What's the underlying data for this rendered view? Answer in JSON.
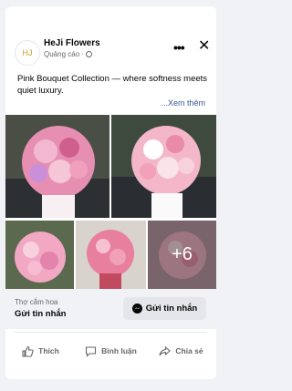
{
  "ad": {
    "page_name": "HeJi Flowers",
    "sponsored_label": "Quảng cáo",
    "avatar_text": "HJ",
    "caption": "Pink Bouquet Collection — where softness meets quiet luxury.",
    "see_more": "...Xem thêm",
    "more_photos": "+6"
  },
  "cta": {
    "subtitle": "Thợ cắm hoa",
    "title": "Gửi tin nhắn",
    "button_label": "Gửi tin nhắn"
  },
  "actions": {
    "like": "Thích",
    "comment": "Bình luận",
    "share": "Chia sẻ"
  },
  "icons": [
    "more-icon",
    "close-icon",
    "globe-icon",
    "messenger-icon",
    "like-icon",
    "comment-icon",
    "share-icon"
  ],
  "colors": {
    "background": "#f0f2f5",
    "text_secondary": "#65676b",
    "link": "#385898",
    "bouquet_pink": "#f4a6c0"
  }
}
